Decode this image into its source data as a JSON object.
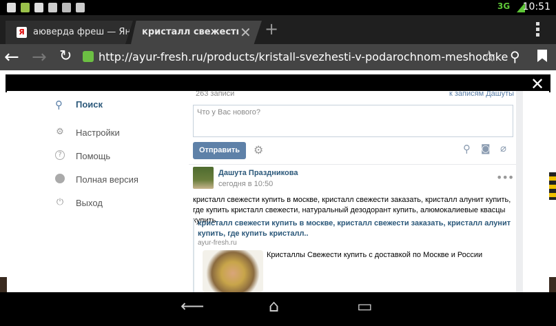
{
  "statusbar": {
    "time": "10:51",
    "network": "3G",
    "signal": "ıl"
  },
  "browser": {
    "tabs": [
      {
        "label": "аюверда фреш — Янд...",
        "favicon": "Я",
        "active": false
      },
      {
        "label": "кристалл свежести к...",
        "active": true
      }
    ],
    "new_tab": "+",
    "url": "http://ayur-fresh.ru/products/kristall-svezhesti-v-podarochnom-meshochke",
    "icons": [
      "back-icon",
      "forward-icon",
      "reload-icon",
      "star-icon",
      "search-icon",
      "bookmark-icon",
      "menu-icon"
    ]
  },
  "modal": {
    "close": "✕",
    "menu": [
      {
        "label": "Поиск",
        "icon": "search-icon",
        "active": true
      },
      {
        "label": "Настройки",
        "icon": "gear-icon"
      },
      {
        "label": "Помощь",
        "icon": "help-icon"
      },
      {
        "label": "Полная версия",
        "icon": "globe-icon"
      },
      {
        "label": "Выход",
        "icon": "power-icon"
      }
    ],
    "feed": {
      "records_count": "263 записи",
      "to_records": "к записям Дашуты",
      "input_placeholder": "Что у Вас нового?",
      "send_label": "Отправить",
      "post": {
        "author": "Дашута Праздникова",
        "time": "сегодня в 10:50",
        "more": "•••",
        "text": "кристалл свежести купить в москве, кристалл свежести заказать, кристалл алунит купить, где купить кристалл свежести, натуральный дезодорант купить, алюмокалиевые квасцы купить",
        "link_title": "кристалл свежести купить в москве, кристалл свежести заказать, кристалл алунит купить, где купить кристалл..",
        "link_domain": "ayur-fresh.ru",
        "link_description": "Кристаллы Свежести купить с доставкой по Москве и России"
      }
    }
  },
  "navbar": {
    "back": "⟵",
    "home": "⌂",
    "recent": "▭"
  }
}
